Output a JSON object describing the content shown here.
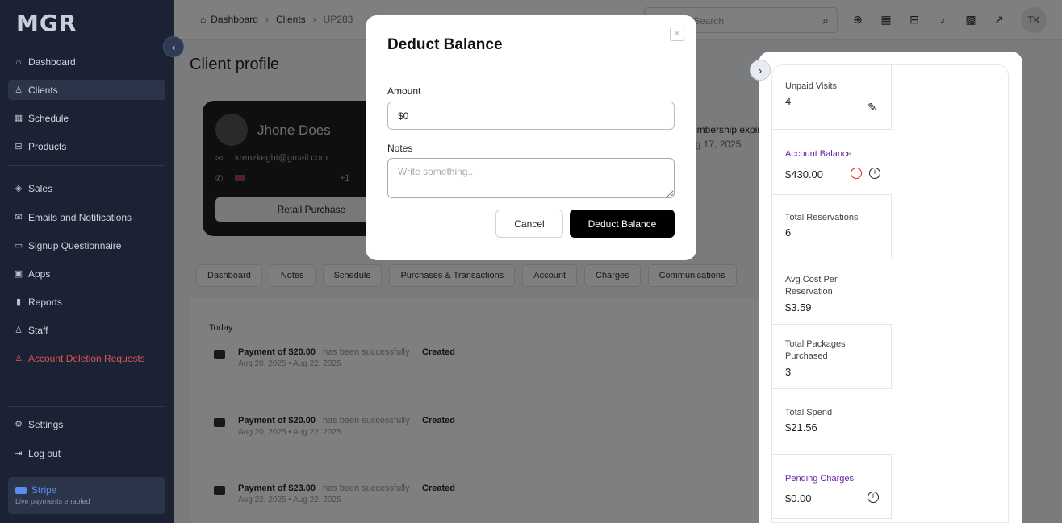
{
  "sidebar": {
    "logo": "MGR",
    "items": [
      {
        "label": "Dashboard",
        "icon": "home-icon"
      },
      {
        "label": "Clients",
        "icon": "user-icon"
      },
      {
        "label": "Schedule",
        "icon": "calendar-icon"
      },
      {
        "label": "Products",
        "icon": "cart-icon"
      },
      {
        "label": "Sales",
        "icon": "box-icon"
      },
      {
        "label": "Emails and Notifications",
        "icon": "mail-icon"
      },
      {
        "label": "Signup Questionnaire",
        "icon": "form-icon"
      },
      {
        "label": "Apps",
        "icon": "apps-icon"
      },
      {
        "label": "Reports",
        "icon": "chart-icon"
      },
      {
        "label": "Staff",
        "icon": "users-icon"
      },
      {
        "label": "Account Deletion Requests",
        "icon": "user-x-icon"
      }
    ],
    "settings": "Settings",
    "logout": "Log out",
    "stripe": {
      "title": "Stripe",
      "subtitle": "Live payments enabled"
    }
  },
  "topbar": {
    "breadcrumb": [
      "Dashboard",
      "Clients",
      "UP283"
    ],
    "search_placeholder": "Search",
    "avatar": "TK"
  },
  "main": {
    "page_title": "Client profile",
    "client": {
      "name": "Jhone Does",
      "email": "krenzkeght@gmail.com",
      "phone_code": "+1",
      "button": "Retail Purchase"
    },
    "membership_label": "Membership expires",
    "membership_date": "Aug 17, 2025",
    "tabs": [
      "Dashboard",
      "Notes",
      "Schedule",
      "Purchases & Transactions",
      "Account",
      "Charges",
      "Communications"
    ],
    "today": "Today",
    "activities": [
      {
        "title": "Payment of $20.00",
        "status": "has been successfully",
        "state": "Created",
        "date": "Aug 20, 2025  •  Aug 22, 2025"
      },
      {
        "title": "Payment of $20.00",
        "status": "has been successfully",
        "state": "Created",
        "date": "Aug 20, 2025  •  Aug 22, 2025"
      },
      {
        "title": "Payment of $23.00",
        "status": "has been successfully",
        "state": "Created",
        "date": "Aug 22, 2025  •  Aug 22, 2025"
      }
    ]
  },
  "right_panel": {
    "stats": [
      {
        "label": "Unpaid Visits",
        "value": "4"
      },
      {
        "label": "Account Balance",
        "value": "$430.00"
      },
      {
        "label": "Total Reservations",
        "value": "6"
      },
      {
        "label": "Avg Cost Per Reservation",
        "value": "$3.59"
      },
      {
        "label": "Total Packages Purchased",
        "value": "3"
      },
      {
        "label": "Total Spend",
        "value": "$21.56"
      },
      {
        "label": "Pending Charges",
        "value": "$0.00"
      }
    ]
  },
  "modal": {
    "title": "Deduct Balance",
    "close": "×",
    "amount_label": "Amount",
    "amount_value": "$0",
    "notes_label": "Notes",
    "notes_placeholder": "Write something..",
    "cancel": "Cancel",
    "submit": "Deduct Balance"
  }
}
